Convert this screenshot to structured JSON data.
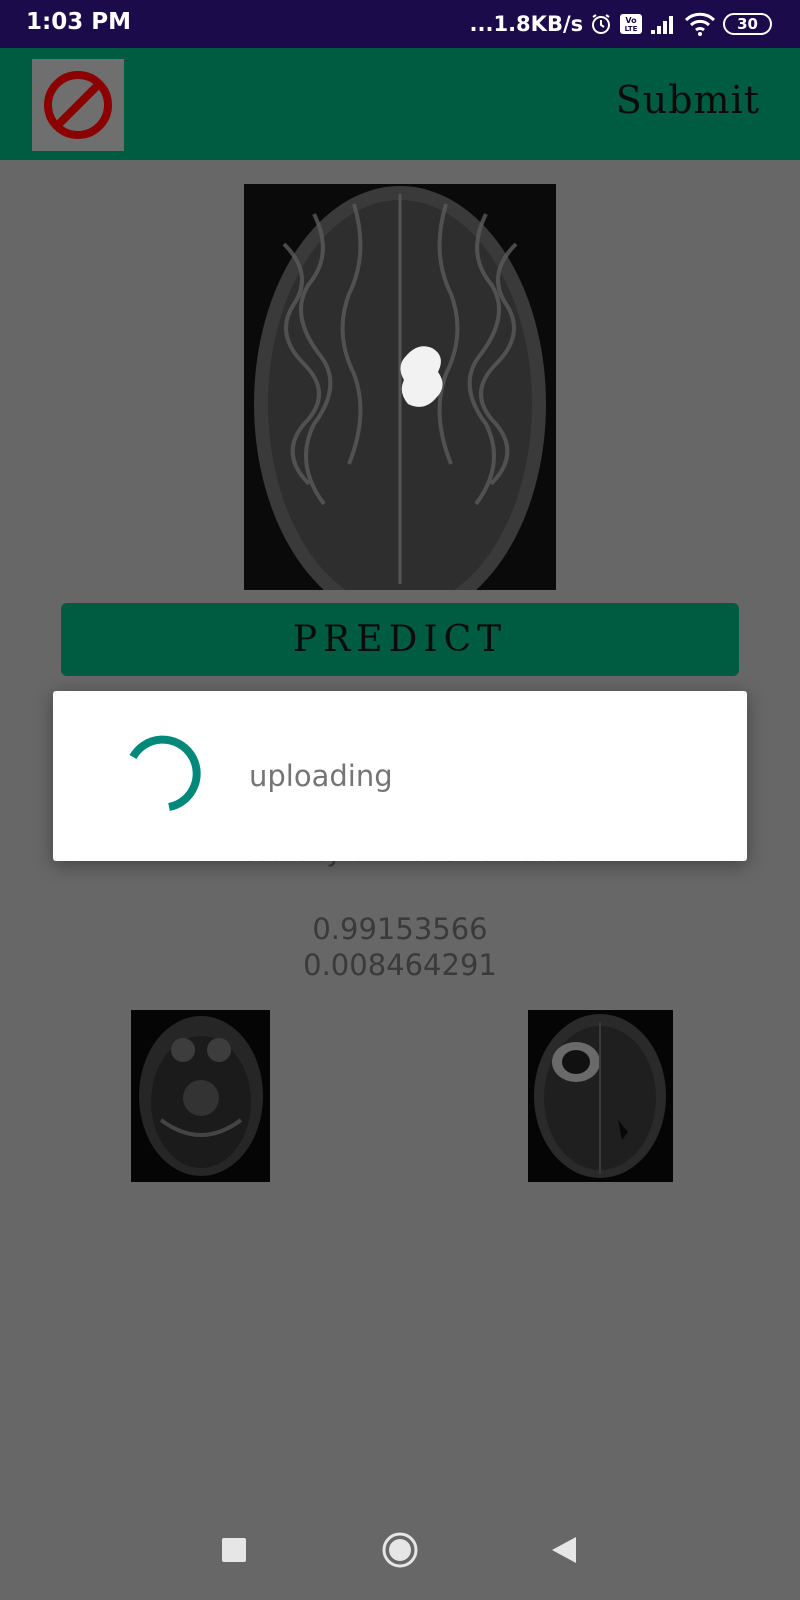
{
  "status_bar": {
    "time": "1:03 PM",
    "net_speed": "...1.8KB/s",
    "battery": "30",
    "icons": [
      "alarm-icon",
      "volte-icon",
      "signal-icon",
      "wifi-icon",
      "battery-icon"
    ]
  },
  "toolbar": {
    "cancel_icon": "no-entry-icon",
    "submit_label": "Submit"
  },
  "main": {
    "predict_label": "PREDICT",
    "accuracy_text": "Accuracy of model is : 98%",
    "value_1": "0.99153566",
    "value_2": "0.008464291"
  },
  "dialog": {
    "message": "uploading"
  },
  "colors": {
    "toolbar": "#005c40",
    "accent": "#00897b",
    "cancel_red": "#8b0000",
    "scrim_background": "#676767"
  },
  "nav": {
    "icons": [
      "recent-apps-icon",
      "home-icon",
      "back-icon"
    ]
  }
}
